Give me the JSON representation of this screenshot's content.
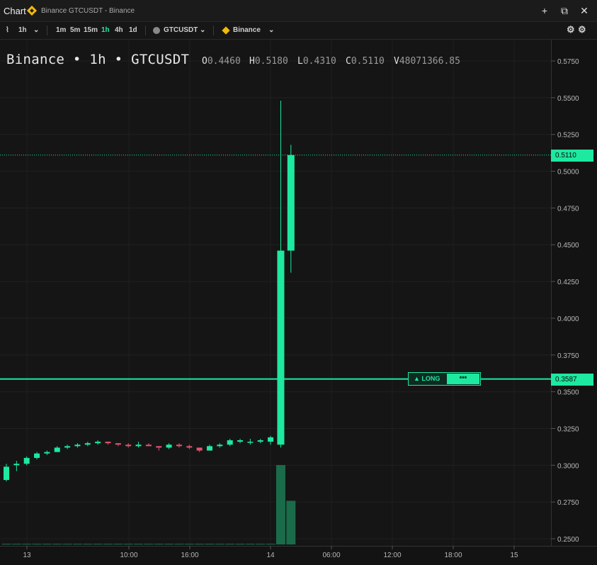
{
  "window": {
    "title": "Chart",
    "subtitle": "Binance GTCUSDT - Binance",
    "btn_add": "+",
    "btn_max": "⧉",
    "btn_close": "✕"
  },
  "toolbar": {
    "interval": "1h",
    "intervals": [
      "1m",
      "5m",
      "15m",
      "1h",
      "4h",
      "1d"
    ],
    "active_interval": "1h",
    "symbol": "GTCUSDT",
    "exchange": "Binance"
  },
  "legend": {
    "title": "Binance • 1h • GTCUSDT",
    "o_label": "O",
    "o": "0.4460",
    "h_label": "H",
    "h": "0.5180",
    "l_label": "L",
    "l": "0.4310",
    "c_label": "C",
    "c": "0.5110",
    "v_label": "V",
    "v": "48071366.85"
  },
  "price_axis": [
    "0.5750",
    "0.5500",
    "0.5250",
    "0.5000",
    "0.4750",
    "0.4500",
    "0.4250",
    "0.4000",
    "0.3750",
    "0.3500",
    "0.3250",
    "0.3000",
    "0.2750",
    "0.2500"
  ],
  "time_axis": [
    "13",
    "10:00",
    "16:00",
    "14",
    "06:00",
    "12:00",
    "18:00",
    "15"
  ],
  "last_price_tag": "0.5110",
  "position_tag": "0.3587",
  "position": {
    "label": "▲ LONG",
    "stars": "***"
  },
  "colors": {
    "up": "#1de9a0",
    "down": "#e0546f",
    "volume": "#1a6b4a"
  },
  "chart_data": {
    "type": "candlestick",
    "candles": [
      {
        "o": 0.29,
        "h": 0.301,
        "l": 0.289,
        "c": 0.299
      },
      {
        "o": 0.3,
        "h": 0.303,
        "l": 0.296,
        "c": 0.301
      },
      {
        "o": 0.301,
        "h": 0.306,
        "l": 0.3,
        "c": 0.305
      },
      {
        "o": 0.305,
        "h": 0.309,
        "l": 0.304,
        "c": 0.308
      },
      {
        "o": 0.308,
        "h": 0.31,
        "l": 0.307,
        "c": 0.309
      },
      {
        "o": 0.309,
        "h": 0.313,
        "l": 0.309,
        "c": 0.312
      },
      {
        "o": 0.312,
        "h": 0.314,
        "l": 0.311,
        "c": 0.313
      },
      {
        "o": 0.313,
        "h": 0.315,
        "l": 0.312,
        "c": 0.314
      },
      {
        "o": 0.314,
        "h": 0.316,
        "l": 0.313,
        "c": 0.315
      },
      {
        "o": 0.315,
        "h": 0.317,
        "l": 0.314,
        "c": 0.316
      },
      {
        "o": 0.316,
        "h": 0.316,
        "l": 0.314,
        "c": 0.315
      },
      {
        "o": 0.315,
        "h": 0.315,
        "l": 0.313,
        "c": 0.314
      },
      {
        "o": 0.314,
        "h": 0.315,
        "l": 0.312,
        "c": 0.313
      },
      {
        "o": 0.313,
        "h": 0.316,
        "l": 0.312,
        "c": 0.314
      },
      {
        "o": 0.314,
        "h": 0.315,
        "l": 0.313,
        "c": 0.313
      },
      {
        "o": 0.313,
        "h": 0.313,
        "l": 0.31,
        "c": 0.312
      },
      {
        "o": 0.312,
        "h": 0.315,
        "l": 0.311,
        "c": 0.314
      },
      {
        "o": 0.314,
        "h": 0.315,
        "l": 0.312,
        "c": 0.313
      },
      {
        "o": 0.313,
        "h": 0.314,
        "l": 0.311,
        "c": 0.312
      },
      {
        "o": 0.312,
        "h": 0.312,
        "l": 0.309,
        "c": 0.31
      },
      {
        "o": 0.31,
        "h": 0.314,
        "l": 0.31,
        "c": 0.313
      },
      {
        "o": 0.313,
        "h": 0.315,
        "l": 0.312,
        "c": 0.314
      },
      {
        "o": 0.314,
        "h": 0.318,
        "l": 0.313,
        "c": 0.317
      },
      {
        "o": 0.316,
        "h": 0.318,
        "l": 0.315,
        "c": 0.317
      },
      {
        "o": 0.316,
        "h": 0.318,
        "l": 0.314,
        "c": 0.316
      },
      {
        "o": 0.316,
        "h": 0.318,
        "l": 0.315,
        "c": 0.317
      },
      {
        "o": 0.316,
        "h": 0.32,
        "l": 0.314,
        "c": 0.319
      },
      {
        "o": 0.314,
        "h": 0.548,
        "l": 0.312,
        "c": 0.446
      },
      {
        "o": 0.446,
        "h": 0.518,
        "l": 0.431,
        "c": 0.511
      }
    ],
    "volume": [
      0.002,
      0.002,
      0.002,
      0.002,
      0.002,
      0.002,
      0.002,
      0.002,
      0.002,
      0.002,
      0.002,
      0.002,
      0.002,
      0.002,
      0.002,
      0.002,
      0.002,
      0.002,
      0.002,
      0.002,
      0.002,
      0.002,
      0.002,
      0.002,
      0.002,
      0.002,
      0.003,
      1.0,
      0.55
    ],
    "ylim": [
      0.2475,
      0.5875
    ],
    "x_ticks": [
      "13",
      "10:00",
      "16:00",
      "14",
      "06:00",
      "12:00",
      "18:00",
      "15"
    ],
    "horizontal_lines": [
      {
        "value": 0.511,
        "style": "dotted"
      },
      {
        "value": 0.3587,
        "style": "solid"
      }
    ],
    "grid": true
  }
}
